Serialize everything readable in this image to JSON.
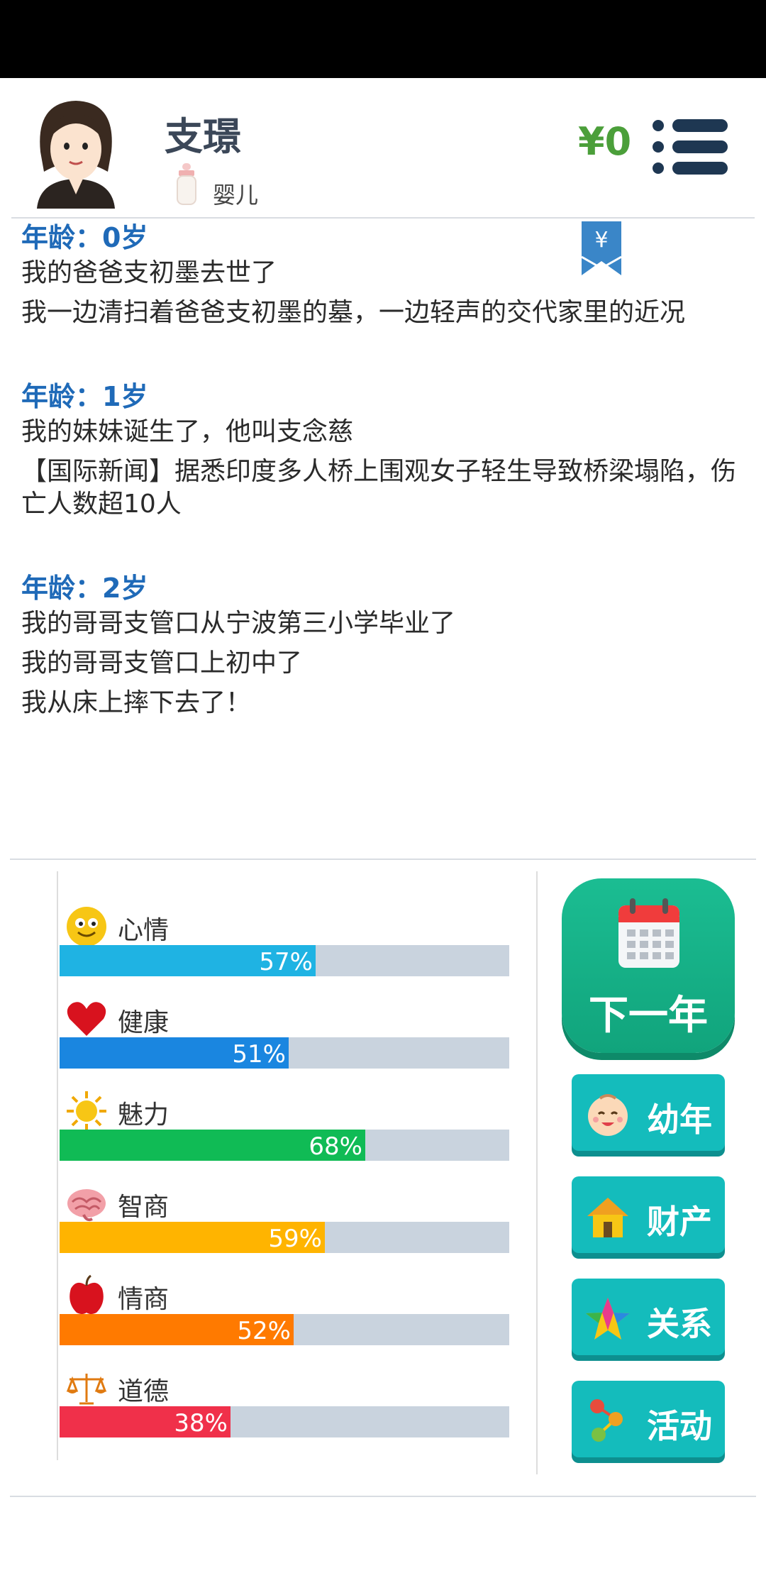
{
  "player": {
    "name": "支璟",
    "stage": "婴儿",
    "money": "¥0"
  },
  "bookmark": {
    "symbol": "¥"
  },
  "log": [
    {
      "age_label": "年龄：0岁",
      "events": [
        "我的爸爸支初墨去世了",
        "我一边清扫着爸爸支初墨的墓，一边轻声的交代家里的近况"
      ]
    },
    {
      "age_label": "年龄：1岁",
      "events": [
        "我的妹妹诞生了，他叫支念慈",
        "【国际新闻】据悉印度多人桥上围观女子轻生导致桥梁塌陷，伤亡人数超10人"
      ]
    },
    {
      "age_label": "年龄：2岁",
      "events": [
        "我的哥哥支管口从宁波第三小学毕业了",
        "我的哥哥支管口上初中了",
        "我从床上摔下去了！"
      ]
    }
  ],
  "stats": [
    {
      "label": "心情",
      "percent": 57,
      "text": "57%",
      "color": "#1fb3e3",
      "icon": "smiley-icon"
    },
    {
      "label": "健康",
      "percent": 51,
      "text": "51%",
      "color": "#1a86e0",
      "icon": "heart-icon"
    },
    {
      "label": "魅力",
      "percent": 68,
      "text": "68%",
      "color": "#10bb55",
      "icon": "sun-icon"
    },
    {
      "label": "智商",
      "percent": 59,
      "text": "59%",
      "color": "#ffb400",
      "icon": "brain-icon"
    },
    {
      "label": "情商",
      "percent": 52,
      "text": "52%",
      "color": "#ff7a00",
      "icon": "apple-icon"
    },
    {
      "label": "道德",
      "percent": 38,
      "text": "38%",
      "color": "#f0304a",
      "icon": "scales-icon"
    }
  ],
  "actions": {
    "next_year": "下一年",
    "childhood": "幼年",
    "assets": "财产",
    "relations": "关系",
    "activities": "活动"
  }
}
